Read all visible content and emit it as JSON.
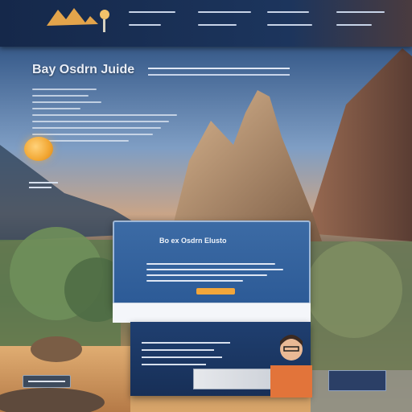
{
  "navbar": {
    "brand_text": "",
    "items": [
      {
        "label": ""
      },
      {
        "label": ""
      },
      {
        "label": ""
      },
      {
        "label": ""
      }
    ]
  },
  "hero": {
    "title": "Bay Osdrn Juide",
    "cta_label": ""
  },
  "card": {
    "title": "Bo ex Osdrn Elusto",
    "button_label": ""
  },
  "strip": {
    "text": ""
  },
  "tag": {
    "label": ""
  },
  "colors": {
    "nav_bg": "#1c355d",
    "accent": "#f2a63a",
    "card_bg": "#2c5a96",
    "panel_bg": "#172f57"
  }
}
